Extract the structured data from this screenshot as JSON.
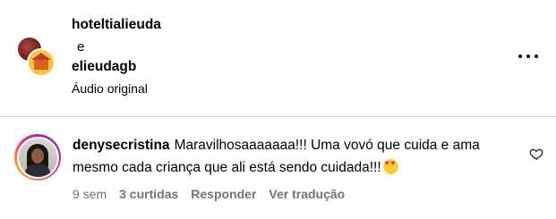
{
  "post_header": {
    "author_1": "hoteltialieuda",
    "separator": "e",
    "author_2": "elieudagb",
    "audio_label": "Áudio original",
    "more_icon": "more-horizontal-icon"
  },
  "comment": {
    "username": "denysecristina",
    "text": "Maravilhosaaaaaaa!!! Uma vovó que cuida e ama mesmo cada criança que ali está sendo cuidada!!!",
    "emoji": "heart-eyes-emoji",
    "age": "9 sem",
    "likes": "3 curtidas",
    "reply_label": "Responder",
    "translate_label": "Ver tradução",
    "like_icon": "heart-outline-icon",
    "ring_colors": [
      "#f9ce34",
      "#ee2a7b",
      "#6228d7"
    ]
  }
}
